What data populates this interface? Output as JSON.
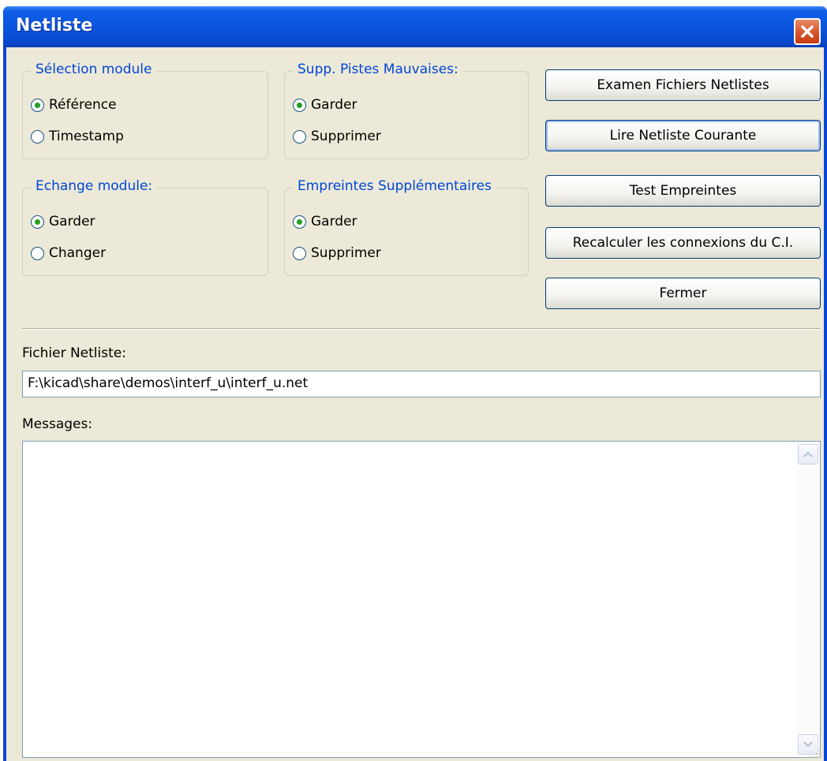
{
  "window": {
    "title": "Netliste"
  },
  "groups": {
    "selection_module": {
      "legend": "Sélection module",
      "options": [
        "Référence",
        "Timestamp"
      ],
      "selected": "Référence"
    },
    "supp_pistes": {
      "legend": "Supp. Pistes Mauvaises:",
      "options": [
        "Garder",
        "Supprimer"
      ],
      "selected": "Garder"
    },
    "echange_module": {
      "legend": "Echange module:",
      "options": [
        "Garder",
        "Changer"
      ],
      "selected": "Garder"
    },
    "empreintes_supp": {
      "legend": "Empreintes Supplémentaires",
      "options": [
        "Garder",
        "Supprimer"
      ],
      "selected": "Garder"
    }
  },
  "buttons": {
    "examen": "Examen Fichiers Netlistes",
    "lire": "Lire Netliste Courante",
    "test": "Test Empreintes",
    "recalculer": "Recalculer les connexions du C.I.",
    "fermer": "Fermer"
  },
  "netlist_file": {
    "label": "Fichier Netliste:",
    "value": "F:\\kicad\\share\\demos\\interf_u\\interf_u.net"
  },
  "messages": {
    "label": "Messages:",
    "content": ""
  },
  "colors": {
    "title_bar": "#0a55de",
    "group_legend": "#0046d5",
    "dialog_bg": "#ece9d8",
    "close_button": "#d9542b",
    "radio_dot": "#21a121"
  }
}
